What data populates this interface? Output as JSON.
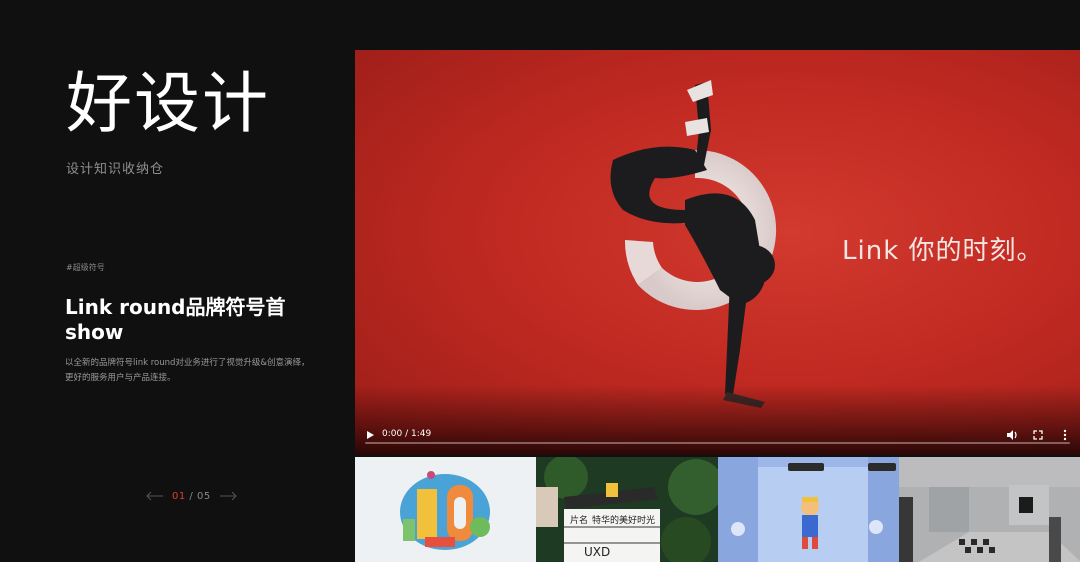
{
  "hero": {
    "title": "好设计",
    "subtitle": "设计知识收纳仓"
  },
  "article": {
    "tag": "#超级符号",
    "title": "Link round品牌符号首show",
    "description": "以全新的品牌符号link round对业务进行了视觉升级&创意演绎，更好的服务用户与产品连接。"
  },
  "pager": {
    "current": "01",
    "separator": "/",
    "total": "05",
    "prev_icon": "arrow-left-icon",
    "next_icon": "arrow-right-icon"
  },
  "video": {
    "caption": "Link 你的时刻。",
    "time": "0:00 / 1:49",
    "progress": 0,
    "colors": {
      "background": "#c12a22",
      "ring": "#e9e3e2"
    },
    "icons": [
      "play-icon",
      "volume-icon",
      "fullscreen-icon",
      "more-options-icon"
    ]
  },
  "thumbnails": [
    {
      "name": "illustration-10-thumbnail"
    },
    {
      "name": "clapperboard-thumbnail",
      "board_text_1": "片名",
      "board_text_2": "特华的美好时光",
      "board_text_3": "UXD"
    },
    {
      "name": "3d-character-thumbnail"
    },
    {
      "name": "interior-room-thumbnail"
    }
  ],
  "colors": {
    "page_bg": "#101010",
    "accent": "#e23c2c"
  }
}
